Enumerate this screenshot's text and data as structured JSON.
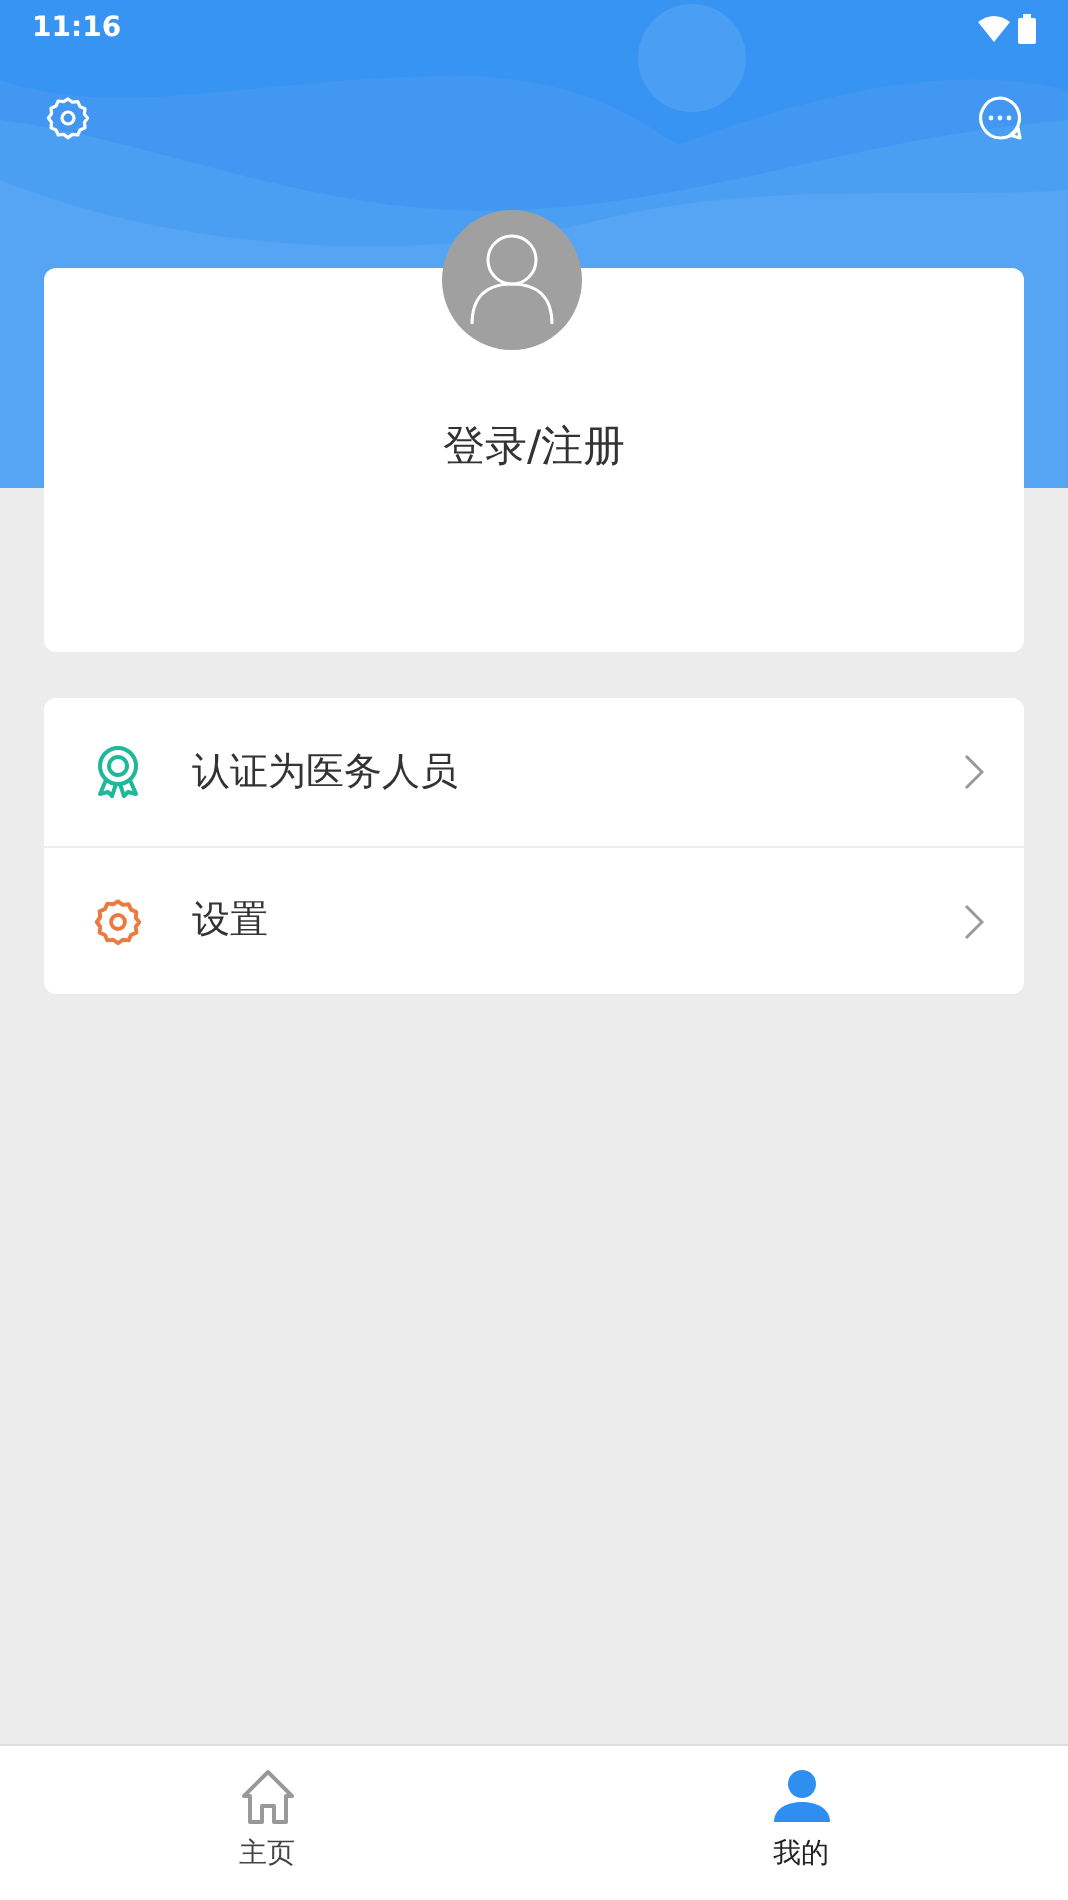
{
  "status_bar": {
    "time": "11:16"
  },
  "profile": {
    "login_label": "登录/注册"
  },
  "menu": [
    {
      "kind": "certify",
      "label": "认证为医务人员"
    },
    {
      "kind": "settings",
      "label": "设置"
    }
  ],
  "tabs": [
    {
      "kind": "home",
      "label": "主页",
      "selected": false
    },
    {
      "kind": "me",
      "label": "我的",
      "selected": true
    }
  ]
}
